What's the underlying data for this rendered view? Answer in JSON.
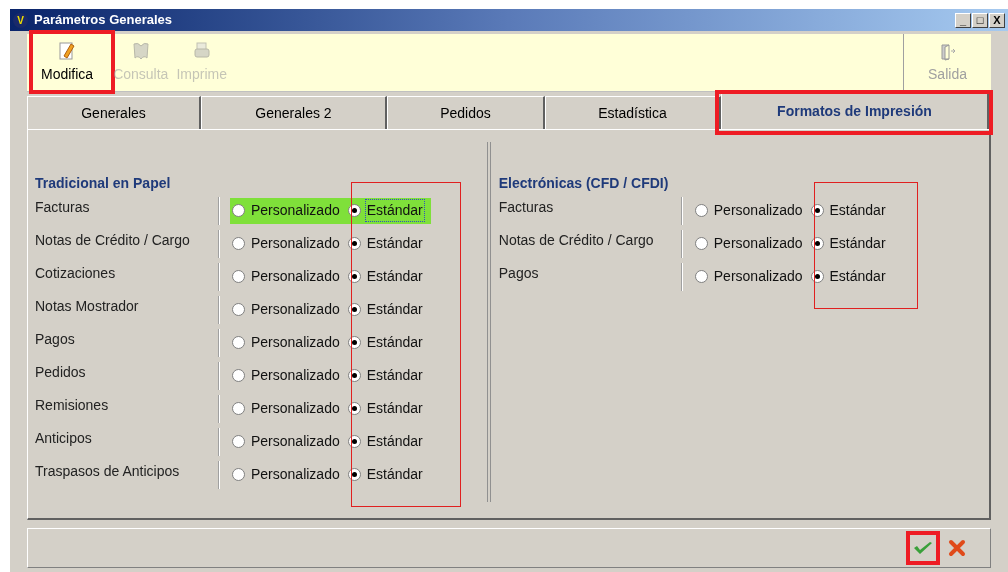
{
  "window": {
    "title": "Parámetros Generales",
    "icon_letter": "V",
    "controls": [
      "_",
      "□",
      "X"
    ]
  },
  "toolbar": {
    "items": [
      {
        "label": "Modifica",
        "kind": "edit",
        "disabled": false,
        "highlighted": true
      },
      {
        "label": "Consulta",
        "kind": "book",
        "disabled": true,
        "highlighted": false
      },
      {
        "label": "Imprime",
        "kind": "print",
        "disabled": true,
        "highlighted": false
      }
    ],
    "exit": {
      "label": "Salida",
      "disabled": true
    }
  },
  "tabs": [
    {
      "label": "Generales",
      "selected": false,
      "highlighted": false
    },
    {
      "label": "Generales 2",
      "selected": false,
      "highlighted": false
    },
    {
      "label": "Pedidos",
      "selected": false,
      "highlighted": false
    },
    {
      "label": "Estadística",
      "selected": false,
      "highlighted": false
    },
    {
      "label": "Formatos de Impresión",
      "selected": true,
      "highlighted": true
    }
  ],
  "sections": [
    {
      "title": "Tradicional en Papel",
      "highlight_standard_column": true,
      "rows": [
        {
          "label": "Facturas",
          "highlighted": true,
          "options": [
            {
              "label": "Personalizado",
              "selected": false,
              "focused": false
            },
            {
              "label": "Estándar",
              "selected": true,
              "focused": true
            }
          ]
        },
        {
          "label": "Notas de Crédito / Cargo",
          "highlighted": false,
          "options": [
            {
              "label": "Personalizado",
              "selected": false,
              "focused": false
            },
            {
              "label": "Estándar",
              "selected": true,
              "focused": false
            }
          ]
        },
        {
          "label": "Cotizaciones",
          "highlighted": false,
          "options": [
            {
              "label": "Personalizado",
              "selected": false,
              "focused": false
            },
            {
              "label": "Estándar",
              "selected": true,
              "focused": false
            }
          ]
        },
        {
          "label": "Notas Mostrador",
          "highlighted": false,
          "options": [
            {
              "label": "Personalizado",
              "selected": false,
              "focused": false
            },
            {
              "label": "Estándar",
              "selected": true,
              "focused": false
            }
          ]
        },
        {
          "label": "Pagos",
          "highlighted": false,
          "options": [
            {
              "label": "Personalizado",
              "selected": false,
              "focused": false
            },
            {
              "label": "Estándar",
              "selected": true,
              "focused": false
            }
          ]
        },
        {
          "label": "Pedidos",
          "highlighted": false,
          "options": [
            {
              "label": "Personalizado",
              "selected": false,
              "focused": false
            },
            {
              "label": "Estándar",
              "selected": true,
              "focused": false
            }
          ]
        },
        {
          "label": "Remisiones",
          "highlighted": false,
          "options": [
            {
              "label": "Personalizado",
              "selected": false,
              "focused": false
            },
            {
              "label": "Estándar",
              "selected": true,
              "focused": false
            }
          ]
        },
        {
          "label": "Anticipos",
          "highlighted": false,
          "options": [
            {
              "label": "Personalizado",
              "selected": false,
              "focused": false
            },
            {
              "label": "Estándar",
              "selected": true,
              "focused": false
            }
          ]
        },
        {
          "label": "Traspasos de Anticipos",
          "highlighted": false,
          "options": [
            {
              "label": "Personalizado",
              "selected": false,
              "focused": false
            },
            {
              "label": "Estándar",
              "selected": true,
              "focused": false
            }
          ]
        }
      ]
    },
    {
      "title": "Electrónicas (CFD / CFDI)",
      "highlight_standard_column": true,
      "rows": [
        {
          "label": "Facturas",
          "highlighted": false,
          "options": [
            {
              "label": "Personalizado",
              "selected": false,
              "focused": false
            },
            {
              "label": "Estándar",
              "selected": true,
              "focused": false
            }
          ]
        },
        {
          "label": "Notas de Crédito / Cargo",
          "highlighted": false,
          "options": [
            {
              "label": "Personalizado",
              "selected": false,
              "focused": false
            },
            {
              "label": "Estándar",
              "selected": true,
              "focused": false
            }
          ]
        },
        {
          "label": "Pagos",
          "highlighted": false,
          "options": [
            {
              "label": "Personalizado",
              "selected": false,
              "focused": false
            },
            {
              "label": "Estándar",
              "selected": true,
              "focused": false
            }
          ]
        }
      ]
    }
  ],
  "footer": {
    "buttons": [
      {
        "kind": "accept",
        "highlighted": true
      },
      {
        "kind": "cancel",
        "highlighted": false
      }
    ]
  }
}
